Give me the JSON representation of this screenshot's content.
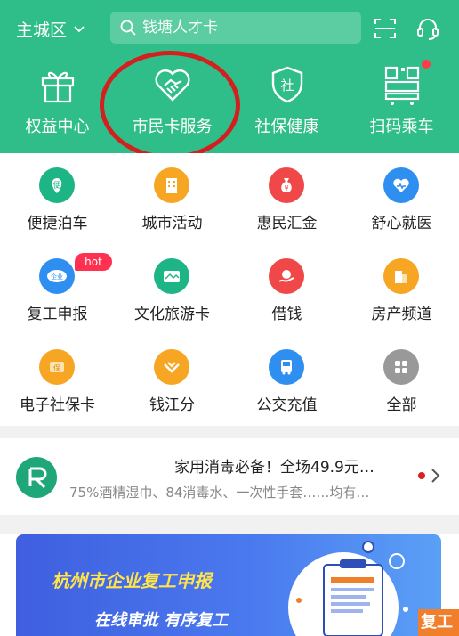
{
  "header": {
    "city": "主城区",
    "search_placeholder": "钱塘人才卡",
    "bg_color": "#2fbe8a",
    "icons": [
      "chevron-down-icon",
      "search-icon",
      "scan-icon",
      "customer-service-icon"
    ]
  },
  "quick_actions": [
    {
      "label": "权益中心",
      "icon": "gift-icon"
    },
    {
      "label": "市民卡服务",
      "icon": "handshake-heart-icon"
    },
    {
      "label": "社保健康",
      "icon": "shield-icon"
    },
    {
      "label": "扫码乘车",
      "icon": "qr-code-icon"
    }
  ],
  "services": [
    {
      "label": "便捷泊车",
      "icon": "parking-icon",
      "color": "#1db585"
    },
    {
      "label": "城市活动",
      "icon": "building-icon",
      "color": "#f6a623"
    },
    {
      "label": "惠民汇金",
      "icon": "money-bag-icon",
      "color": "#f04848"
    },
    {
      "label": "舒心就医",
      "icon": "medical-heart-icon",
      "color": "#2e8ff0"
    },
    {
      "label": "复工申报",
      "icon": "enterprise-icon",
      "color": "#2e8ff0"
    },
    {
      "label": "文化旅游卡",
      "icon": "travel-card-icon",
      "color": "#1db585"
    },
    {
      "label": "借钱",
      "icon": "loan-icon",
      "color": "#f04848"
    },
    {
      "label": "房产频道",
      "icon": "house-icon",
      "color": "#f6a623"
    },
    {
      "label": "电子社保卡",
      "icon": "social-card-icon",
      "color": "#f6a623"
    },
    {
      "label": "钱江分",
      "icon": "score-icon",
      "color": "#f6a623"
    },
    {
      "label": "公交充值",
      "icon": "bus-icon",
      "color": "#2e8ff0"
    },
    {
      "label": "全部",
      "icon": "all-apps-icon",
      "color": "#999999"
    }
  ],
  "hot_badge": "hot",
  "promo": {
    "title": "家用消毒必备！全场49.9元…",
    "subtitle": "75%酒精湿巾、84消毒水、一次性手套……均有…"
  },
  "banner": {
    "title": "杭州市企业复工申报",
    "subtitle": "在线审批 有序复工",
    "corner": "复工"
  }
}
